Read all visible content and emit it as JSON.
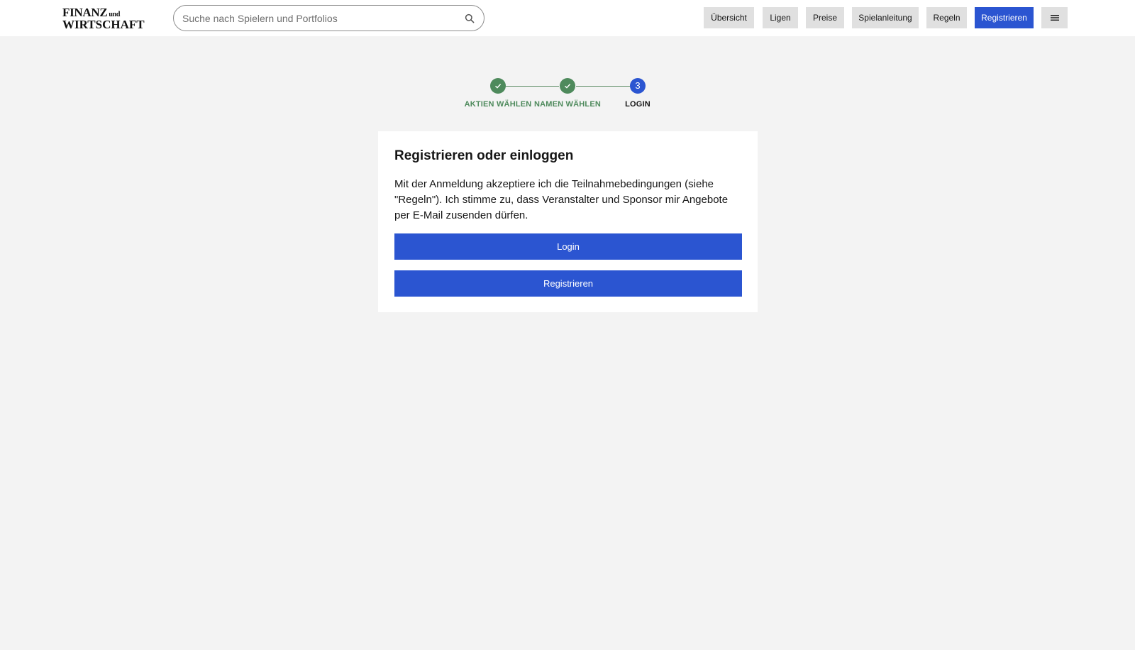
{
  "header": {
    "logo_line1": "FINANZ",
    "logo_und": "und",
    "logo_line2": "WIRTSCHAFT",
    "search_placeholder": "Suche nach Spielern und Portfolios",
    "nav": [
      "Übersicht",
      "Ligen",
      "Preise",
      "Spielanleitung",
      "Regeln"
    ],
    "register_label": "Registrieren",
    "icons": {
      "search": "search-icon",
      "menu": "menu-icon"
    }
  },
  "stepper": {
    "steps": [
      {
        "label": "AKTIEN WÄHLEN",
        "state": "done"
      },
      {
        "label": "NAMEN WÄHLEN",
        "state": "done"
      },
      {
        "label": "LOGIN",
        "state": "active",
        "number": "3"
      }
    ]
  },
  "card": {
    "title": "Registrieren oder einloggen",
    "text": "Mit der Anmeldung akzeptiere ich die Teilnahmebedingungen (siehe \"Regeln\"). Ich stimme zu, dass Veranstalter und Sponsor mir Angebote per E-Mail zusenden dürfen.",
    "login_label": "Login",
    "register_label": "Registrieren"
  },
  "colors": {
    "primary": "#2b55d1",
    "success": "#4e8a5c",
    "background": "#f3f3f3",
    "nav_button": "#e0e0e0"
  }
}
